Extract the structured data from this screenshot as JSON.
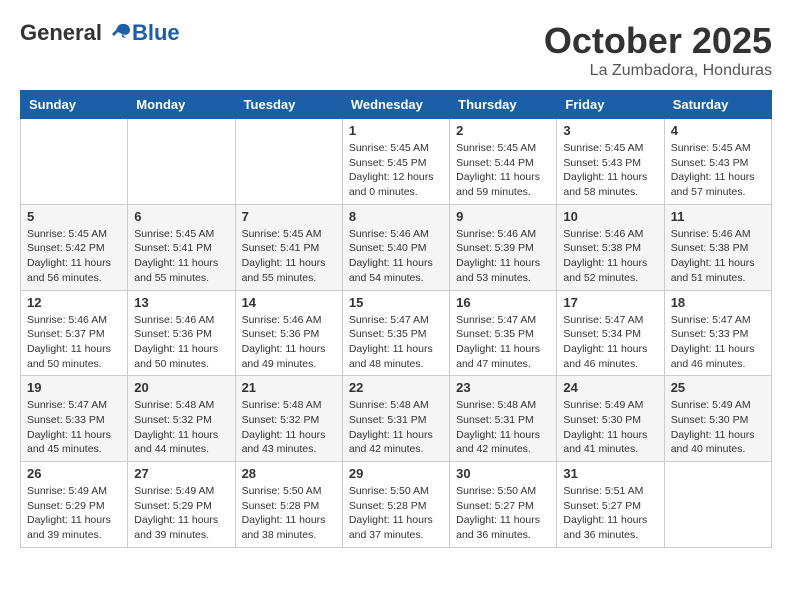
{
  "header": {
    "logo": {
      "general": "General",
      "blue": "Blue"
    },
    "title": "October 2025",
    "subtitle": "La Zumbadora, Honduras"
  },
  "weekdays": [
    "Sunday",
    "Monday",
    "Tuesday",
    "Wednesday",
    "Thursday",
    "Friday",
    "Saturday"
  ],
  "weeks": [
    {
      "days": [
        {
          "number": "",
          "info": ""
        },
        {
          "number": "",
          "info": ""
        },
        {
          "number": "",
          "info": ""
        },
        {
          "number": "1",
          "info": "Sunrise: 5:45 AM\nSunset: 5:45 PM\nDaylight: 12 hours\nand 0 minutes."
        },
        {
          "number": "2",
          "info": "Sunrise: 5:45 AM\nSunset: 5:44 PM\nDaylight: 11 hours\nand 59 minutes."
        },
        {
          "number": "3",
          "info": "Sunrise: 5:45 AM\nSunset: 5:43 PM\nDaylight: 11 hours\nand 58 minutes."
        },
        {
          "number": "4",
          "info": "Sunrise: 5:45 AM\nSunset: 5:43 PM\nDaylight: 11 hours\nand 57 minutes."
        }
      ]
    },
    {
      "days": [
        {
          "number": "5",
          "info": "Sunrise: 5:45 AM\nSunset: 5:42 PM\nDaylight: 11 hours\nand 56 minutes."
        },
        {
          "number": "6",
          "info": "Sunrise: 5:45 AM\nSunset: 5:41 PM\nDaylight: 11 hours\nand 55 minutes."
        },
        {
          "number": "7",
          "info": "Sunrise: 5:45 AM\nSunset: 5:41 PM\nDaylight: 11 hours\nand 55 minutes."
        },
        {
          "number": "8",
          "info": "Sunrise: 5:46 AM\nSunset: 5:40 PM\nDaylight: 11 hours\nand 54 minutes."
        },
        {
          "number": "9",
          "info": "Sunrise: 5:46 AM\nSunset: 5:39 PM\nDaylight: 11 hours\nand 53 minutes."
        },
        {
          "number": "10",
          "info": "Sunrise: 5:46 AM\nSunset: 5:38 PM\nDaylight: 11 hours\nand 52 minutes."
        },
        {
          "number": "11",
          "info": "Sunrise: 5:46 AM\nSunset: 5:38 PM\nDaylight: 11 hours\nand 51 minutes."
        }
      ]
    },
    {
      "days": [
        {
          "number": "12",
          "info": "Sunrise: 5:46 AM\nSunset: 5:37 PM\nDaylight: 11 hours\nand 50 minutes."
        },
        {
          "number": "13",
          "info": "Sunrise: 5:46 AM\nSunset: 5:36 PM\nDaylight: 11 hours\nand 50 minutes."
        },
        {
          "number": "14",
          "info": "Sunrise: 5:46 AM\nSunset: 5:36 PM\nDaylight: 11 hours\nand 49 minutes."
        },
        {
          "number": "15",
          "info": "Sunrise: 5:47 AM\nSunset: 5:35 PM\nDaylight: 11 hours\nand 48 minutes."
        },
        {
          "number": "16",
          "info": "Sunrise: 5:47 AM\nSunset: 5:35 PM\nDaylight: 11 hours\nand 47 minutes."
        },
        {
          "number": "17",
          "info": "Sunrise: 5:47 AM\nSunset: 5:34 PM\nDaylight: 11 hours\nand 46 minutes."
        },
        {
          "number": "18",
          "info": "Sunrise: 5:47 AM\nSunset: 5:33 PM\nDaylight: 11 hours\nand 46 minutes."
        }
      ]
    },
    {
      "days": [
        {
          "number": "19",
          "info": "Sunrise: 5:47 AM\nSunset: 5:33 PM\nDaylight: 11 hours\nand 45 minutes."
        },
        {
          "number": "20",
          "info": "Sunrise: 5:48 AM\nSunset: 5:32 PM\nDaylight: 11 hours\nand 44 minutes."
        },
        {
          "number": "21",
          "info": "Sunrise: 5:48 AM\nSunset: 5:32 PM\nDaylight: 11 hours\nand 43 minutes."
        },
        {
          "number": "22",
          "info": "Sunrise: 5:48 AM\nSunset: 5:31 PM\nDaylight: 11 hours\nand 42 minutes."
        },
        {
          "number": "23",
          "info": "Sunrise: 5:48 AM\nSunset: 5:31 PM\nDaylight: 11 hours\nand 42 minutes."
        },
        {
          "number": "24",
          "info": "Sunrise: 5:49 AM\nSunset: 5:30 PM\nDaylight: 11 hours\nand 41 minutes."
        },
        {
          "number": "25",
          "info": "Sunrise: 5:49 AM\nSunset: 5:30 PM\nDaylight: 11 hours\nand 40 minutes."
        }
      ]
    },
    {
      "days": [
        {
          "number": "26",
          "info": "Sunrise: 5:49 AM\nSunset: 5:29 PM\nDaylight: 11 hours\nand 39 minutes."
        },
        {
          "number": "27",
          "info": "Sunrise: 5:49 AM\nSunset: 5:29 PM\nDaylight: 11 hours\nand 39 minutes."
        },
        {
          "number": "28",
          "info": "Sunrise: 5:50 AM\nSunset: 5:28 PM\nDaylight: 11 hours\nand 38 minutes."
        },
        {
          "number": "29",
          "info": "Sunrise: 5:50 AM\nSunset: 5:28 PM\nDaylight: 11 hours\nand 37 minutes."
        },
        {
          "number": "30",
          "info": "Sunrise: 5:50 AM\nSunset: 5:27 PM\nDaylight: 11 hours\nand 36 minutes."
        },
        {
          "number": "31",
          "info": "Sunrise: 5:51 AM\nSunset: 5:27 PM\nDaylight: 11 hours\nand 36 minutes."
        },
        {
          "number": "",
          "info": ""
        }
      ]
    }
  ]
}
